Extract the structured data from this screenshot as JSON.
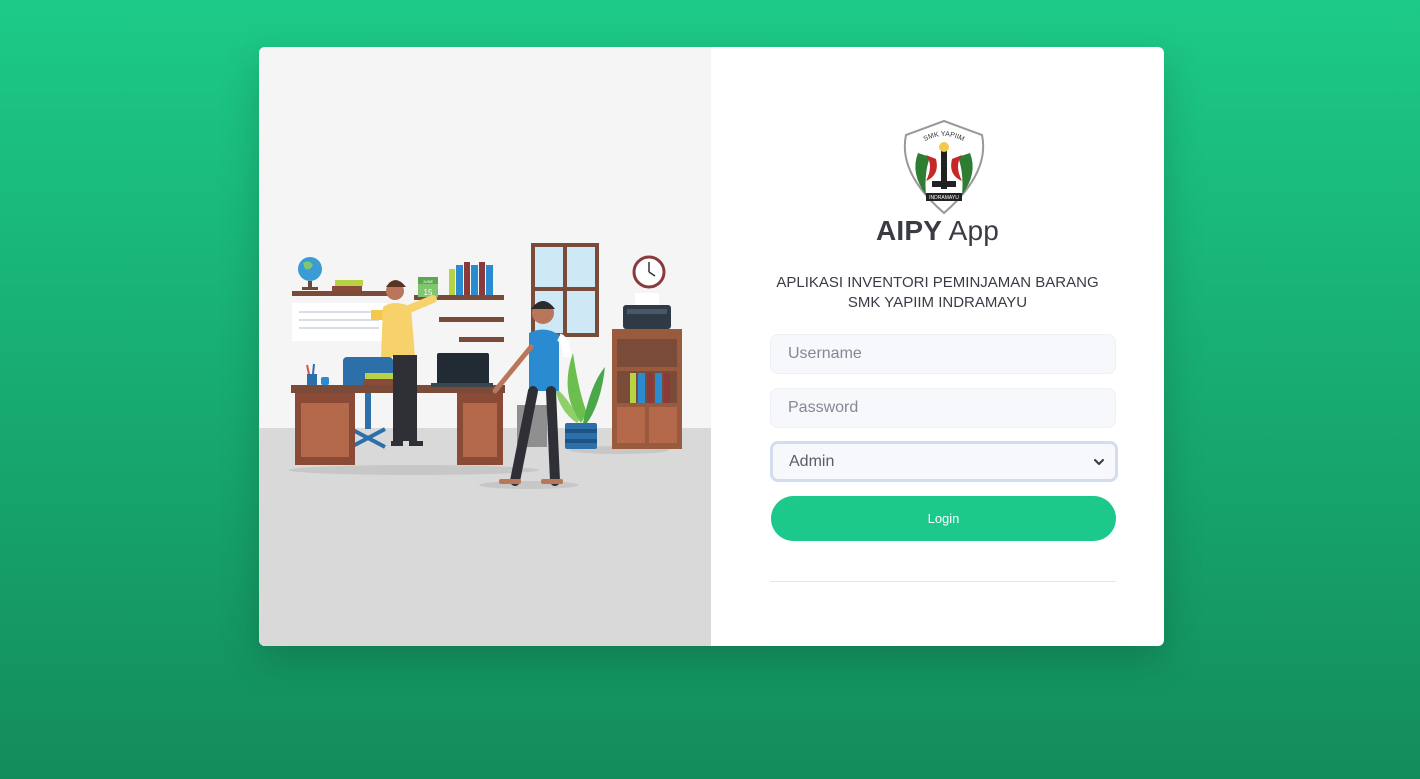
{
  "app": {
    "title_bold": "AIPY",
    "title_rest": "App",
    "subtitle_line1": "APLIKASI INVENTORI PEMINJAMAN BARANG",
    "subtitle_line2": "SMK YAPIIM INDRAMAYU"
  },
  "logo": {
    "icon": "school-crest-icon",
    "text_top": "SMK YAPIIM",
    "text_bottom": "INDRAMAYU"
  },
  "illustration": {
    "icon": "office-scene-illustration",
    "calendar_month": "JUNE",
    "calendar_day": "15"
  },
  "form": {
    "username_placeholder": "Username",
    "password_placeholder": "Password",
    "role_selected": "Admin",
    "login_label": "Login"
  },
  "colors": {
    "background": "#1dca88",
    "accent": "#1cc88a",
    "text": "#3a3b45"
  }
}
